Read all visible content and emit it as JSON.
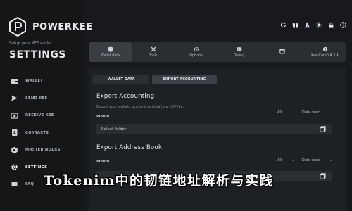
{
  "app": {
    "brand": "POWERKEE",
    "setup_line": "Setup your KEE wallet",
    "section": "SETTINGS"
  },
  "sidebar": {
    "items": [
      {
        "label": "WALLET",
        "icon": "wallet-icon"
      },
      {
        "label": "SEND KEE",
        "icon": "send-icon"
      },
      {
        "label": "RECEIVE KEE",
        "icon": "receive-icon"
      },
      {
        "label": "CONTACTS",
        "icon": "contacts-icon"
      },
      {
        "label": "MASTER NODES",
        "icon": "masternodes-icon"
      },
      {
        "label": "SETTINGS",
        "icon": "gear-icon"
      },
      {
        "label": "FAQ",
        "icon": "faq-icon"
      }
    ]
  },
  "topbar": {
    "icons": [
      "refresh-icon",
      "gift-icon",
      "flask-icon",
      "brightness-icon",
      "lock-icon",
      "help-icon"
    ]
  },
  "tabs": [
    {
      "label": "Wallet data",
      "icon": "database-icon"
    },
    {
      "label": "Tools",
      "icon": "tools-icon"
    },
    {
      "label": "Options",
      "icon": "options-icon"
    },
    {
      "label": "Debug",
      "icon": "debug-icon"
    },
    {
      "label": "",
      "icon": "window-icon"
    },
    {
      "label": "Kee Core V4.3.4",
      "icon": "info-icon"
    }
  ],
  "subtabs": {
    "wallet": "WALLET DATA",
    "export": "EXPORT ACCOUNTING"
  },
  "export_accounting": {
    "title": "Export Accounting",
    "desc": "Export your wallets accounting data to a CSV file.",
    "where": "Where",
    "filter": "All",
    "sort": "Date desc",
    "folder": "Select folder"
  },
  "export_address": {
    "title": "Export Address Book",
    "where": "Where",
    "filter": "All",
    "sort": "Date desc"
  },
  "overlay": {
    "text": "Tokenim中的韧链地址解析与实践"
  },
  "colors": {
    "background": "#17191c",
    "panel": "#1e2124",
    "tabbar": "#2a2d31"
  }
}
